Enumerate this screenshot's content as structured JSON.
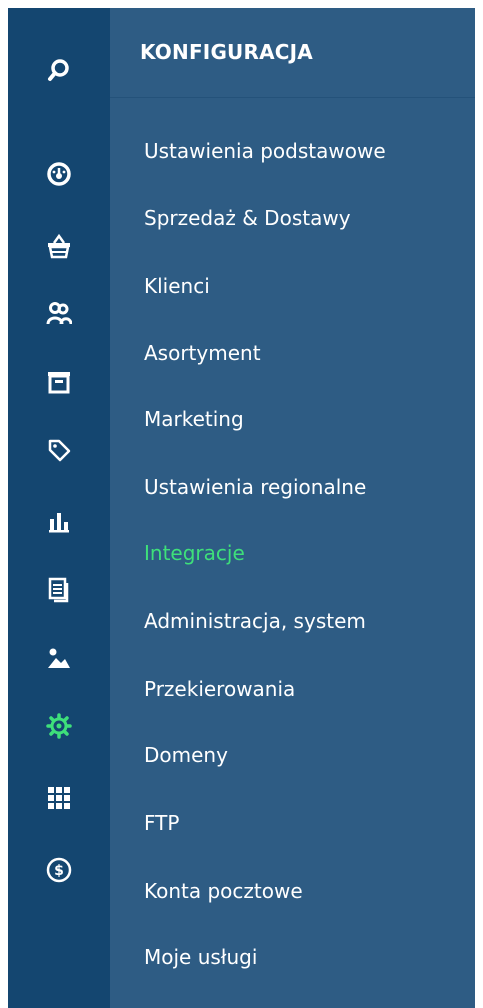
{
  "sidebar": {
    "icons": [
      {
        "name": "search-icon"
      },
      {
        "name": "dashboard-icon"
      },
      {
        "name": "basket-icon"
      },
      {
        "name": "users-icon"
      },
      {
        "name": "archive-icon"
      },
      {
        "name": "tag-icon"
      },
      {
        "name": "bar-chart-icon"
      },
      {
        "name": "documents-icon"
      },
      {
        "name": "image-icon"
      },
      {
        "name": "gear-icon",
        "active": true
      },
      {
        "name": "apps-grid-icon"
      },
      {
        "name": "dollar-icon"
      }
    ],
    "icon_color": "#ffffff",
    "active_icon_color": "#3ee07a"
  },
  "menu": {
    "title": "KONFIGURACJA",
    "items": [
      {
        "label": "Ustawienia podstawowe"
      },
      {
        "label": "Sprzedaż & Dostawy"
      },
      {
        "label": "Klienci"
      },
      {
        "label": "Asortyment"
      },
      {
        "label": "Marketing"
      },
      {
        "label": "Ustawienia regionalne"
      },
      {
        "label": "Integracje",
        "active": true
      },
      {
        "label": "Administracja, system"
      },
      {
        "label": "Przekierowania"
      },
      {
        "label": "Domeny"
      },
      {
        "label": "FTP"
      },
      {
        "label": "Konta pocztowe"
      },
      {
        "label": "Moje usługi"
      }
    ]
  },
  "colors": {
    "rail_bg": "#144670",
    "panel_bg": "#2e5c84",
    "text": "#ffffff",
    "accent": "#3ee07a"
  }
}
